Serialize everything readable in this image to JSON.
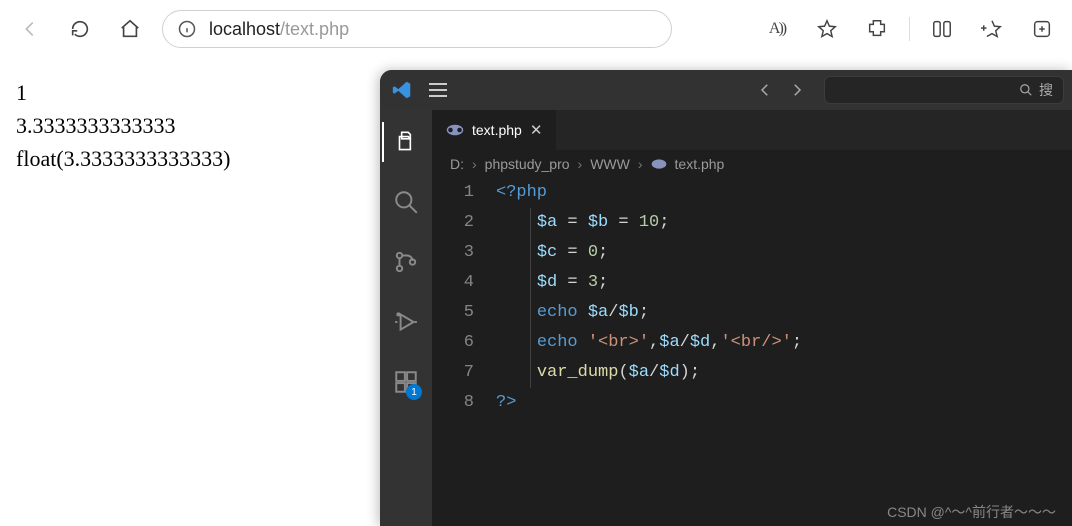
{
  "toolbar": {
    "url_host": "localhost",
    "url_path": "/text.php",
    "aa_label": "A))",
    "search_placeholder": "搜"
  },
  "page_output": {
    "line1": "1",
    "line2": "3.3333333333333",
    "line3": "float(3.3333333333333)"
  },
  "vscode": {
    "tab": {
      "filename": "text.php"
    },
    "breadcrumb": {
      "p0": "D:",
      "p1": "phpstudy_pro",
      "p2": "WWW",
      "p3": "text.php"
    },
    "ext_badge": "1",
    "gutter": [
      "1",
      "2",
      "3",
      "4",
      "5",
      "6",
      "7",
      "8"
    ],
    "code": {
      "open_tag": "<?php",
      "l2": {
        "va": "$a",
        "eq1": " = ",
        "vb": "$b",
        "eq2": " = ",
        "num": "10",
        "semi": ";"
      },
      "l3": {
        "vc": "$c",
        "eq": " = ",
        "num": "0",
        "semi": ";"
      },
      "l4": {
        "vd": "$d",
        "eq": " = ",
        "num": "3",
        "semi": ";"
      },
      "l5": {
        "kw": "echo",
        "sp": " ",
        "va": "$a",
        "op": "/",
        "vb": "$b",
        "semi": ";"
      },
      "l6": {
        "kw": "echo",
        "sp": " ",
        "s1": "'<br>'",
        "c1": ",",
        "va": "$a",
        "op": "/",
        "vd": "$d",
        "c2": ",",
        "s2": "'<br/>'",
        "semi": ";"
      },
      "l7": {
        "fn": "var_dump",
        "lp": "(",
        "va": "$a",
        "op": "/",
        "vd": "$d",
        "rp": ")",
        "semi": ";"
      },
      "close_tag": "?>"
    },
    "watermark": "CSDN @^～^前行者～～～"
  }
}
